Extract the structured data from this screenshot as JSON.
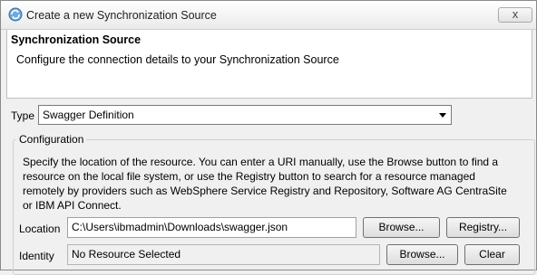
{
  "window": {
    "title": "Create a new Synchronization Source",
    "icon": "sync-source-icon",
    "close_glyph": "x"
  },
  "header": {
    "title": "Synchronization Source",
    "description": "Configure the connection details to your Synchronization Source"
  },
  "type": {
    "label": "Type",
    "selected": "Swagger Definition"
  },
  "configuration": {
    "title": "Configuration",
    "instructions": [
      "Specify the location of the resource.  You can enter a URI manually, use the Browse button to find a",
      "resource on the local file system, or use the Registry button to search for a resource managed",
      "remotely by providers such as WebSphere Service Registry and Repository, Software AG CentraSite",
      "or IBM API Connect."
    ],
    "location": {
      "label": "Location",
      "value": "C:\\Users\\ibmadmin\\Downloads\\swagger.json",
      "browse_label": "Browse...",
      "registry_label": "Registry..."
    },
    "identity": {
      "label": "Identity",
      "value": "No Resource Selected",
      "browse_label": "Browse...",
      "clear_label": "Clear"
    }
  }
}
